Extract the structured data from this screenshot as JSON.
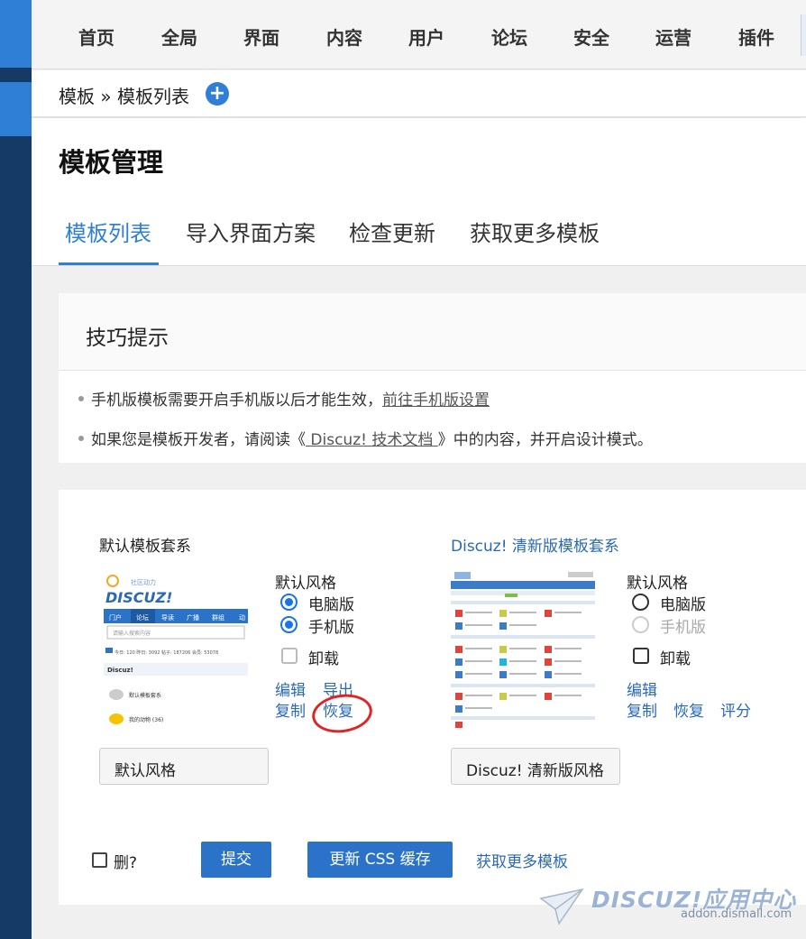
{
  "nav": {
    "items": [
      "首页",
      "全局",
      "界面",
      "内容",
      "用户",
      "论坛",
      "安全",
      "运营",
      "插件"
    ]
  },
  "breadcrumb": {
    "text": "模板 » 模板列表",
    "add_icon": "plus-circle-icon"
  },
  "page": {
    "title": "模板管理"
  },
  "tabs": [
    {
      "label": "模板列表",
      "active": true
    },
    {
      "label": "导入界面方案",
      "active": false
    },
    {
      "label": "检查更新",
      "active": false
    },
    {
      "label": "获取更多模板",
      "active": false
    }
  ],
  "tips": {
    "title": "技巧提示",
    "line1_text": "手机版模板需要开启手机版以后才能生效，",
    "line1_link": "前往手机版设置",
    "line2_pre": "如果您是模板开发者，请阅读《",
    "line2_link": " Discuz! 技术文档 ",
    "line2_post": "》中的内容，并开启设计模式。"
  },
  "templates": [
    {
      "name": "默认模板套系",
      "style_label": "默认风格",
      "opt_pc": "电脑版",
      "opt_mobile": "手机版",
      "opt_uninstall": "卸载",
      "actions": [
        "编辑",
        "导出",
        "复制",
        "恢复"
      ],
      "style_name": "默认风格",
      "thumb_logo": "DISCUZ!",
      "thumb_slogan": "社区动力",
      "thumb_nav": [
        "门户",
        "论坛",
        "导读",
        "广播",
        "群组",
        "动"
      ],
      "thumb_search": "请输入搜索内容",
      "thumb_stats": "今日: 120 昨日: 3092 帖子: 187206 会员: 53078",
      "thumb_section": "Discuz!",
      "thumb_forum1": "默认模板套系",
      "thumb_forum2": "我的动物 (36)"
    },
    {
      "name": "Discuz! 清新版模板套系",
      "style_label": "默认风格",
      "opt_pc": "电脑版",
      "opt_mobile": "手机版",
      "opt_uninstall": "卸载",
      "actions": [
        "编辑",
        "复制",
        "恢复",
        "评分"
      ],
      "style_name": "Discuz! 清新版风格"
    }
  ],
  "footer": {
    "delete_label": "删?",
    "submit": "提交",
    "update_css": "更新 CSS 缓存",
    "more_link": "获取更多模板"
  },
  "watermark": {
    "brand": "DISCUZ!应用中心",
    "url": "addon.dismall.com"
  },
  "colors": {
    "accent": "#2f7fd6",
    "sidebar": "#163a66",
    "link": "#2a6ab4",
    "annotation": "#e02424"
  }
}
